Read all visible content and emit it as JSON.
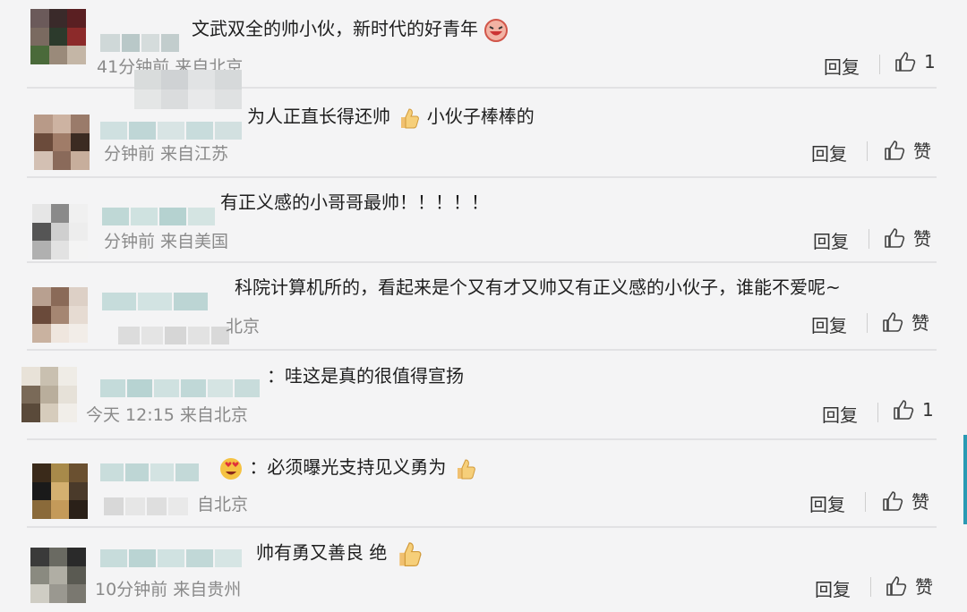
{
  "comments": [
    {
      "content": "文武双全的帅小伙，新时代的好青年",
      "meta": "41分钟前 来自北京",
      "reply": "回复",
      "like": "1"
    },
    {
      "content": "为人正直长得还帅",
      "content2": "小伙子棒棒的",
      "meta": "分钟前 来自江苏",
      "reply": "回复",
      "like": "赞"
    },
    {
      "content": "有正义感的小哥哥最帅！！！！！",
      "meta": "分钟前 来自美国",
      "reply": "回复",
      "like": "赞"
    },
    {
      "content": "科院计算机所的，看起来是个又有才又帅又有正义感的小伙子，谁能不爱呢~",
      "meta": "北京",
      "reply": "回复",
      "like": "赞"
    },
    {
      "content": "：哇这是真的很值得宣扬",
      "meta": "今天 12:15 来自北京",
      "reply": "回复",
      "like": "1"
    },
    {
      "content": "：必须曝光支持见义勇为",
      "meta": "自北京",
      "reply": "回复",
      "like": "赞"
    },
    {
      "content": "帅有勇又善良 绝",
      "meta": "10分钟前 来自贵州",
      "reply": "回复",
      "like": "赞"
    }
  ],
  "icons": {
    "like": "thumbs-up-icon",
    "thumb_emoji": "thumbs-up-emoji",
    "face_emoji": "laughing-face-emoji",
    "heart_eyes_emoji": "heart-eyes-emoji"
  },
  "colors": {
    "background": "#f4f4f5",
    "text": "#1e1e1e",
    "meta": "#8a8a8a"
  }
}
